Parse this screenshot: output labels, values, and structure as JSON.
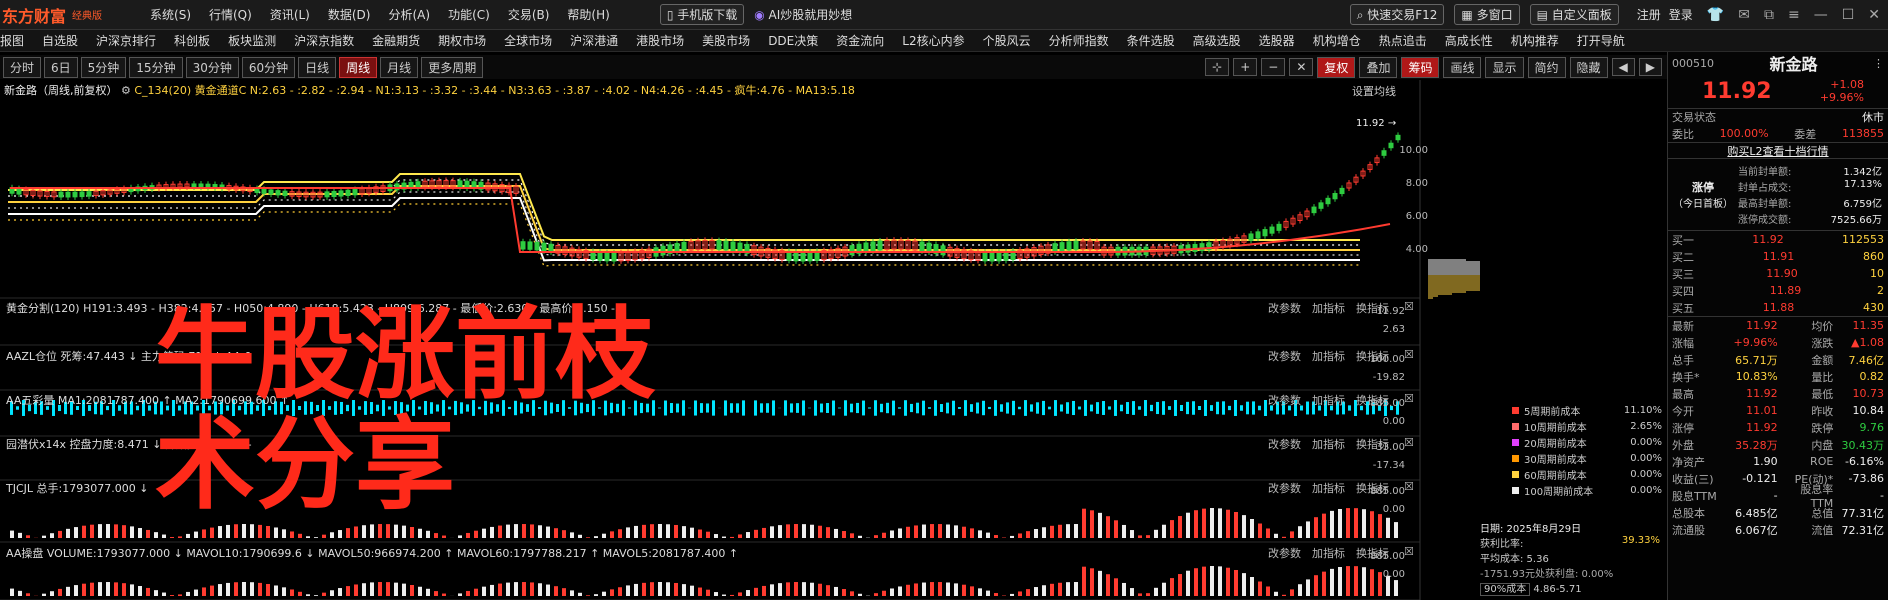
{
  "topbar": {
    "logo": "东方财富",
    "edition": "经典版",
    "menus": [
      "系统(S)",
      "行情(Q)",
      "资讯(L)",
      "数据(D)",
      "分析(A)",
      "功能(C)",
      "交易(B)",
      "帮助(H)"
    ],
    "mobile_download": "手机版下载",
    "ai_promo": "AI炒股就用妙想",
    "quick_trade": "快速交易F12",
    "multi_window": "多窗口",
    "custom_panel": "自定义面板",
    "register": "注册",
    "login": "登录"
  },
  "navrow": [
    "报图",
    "自选股",
    "沪深京排行",
    "科创板",
    "板块监测",
    "沪深京指数",
    "金融期货",
    "期权市场",
    "全球市场",
    "沪深港通",
    "港股市场",
    "美股市场",
    "DDE决策",
    "资金流向",
    "L2核心内参",
    "个股风云",
    "分析师指数",
    "条件选股",
    "高级选股",
    "选股器",
    "机构增仓",
    "热点追击",
    "高成长性",
    "机构推荐",
    "打开导航"
  ],
  "periods": [
    "分时",
    "6日",
    "5分钟",
    "15分钟",
    "30分钟",
    "60分钟",
    "日线",
    "周线",
    "月线",
    "更多周期"
  ],
  "period_selected": "周线",
  "tools": {
    "fuquan": "复权",
    "diejia": "叠加",
    "chouma": "筹码",
    "huaxian": "画线",
    "xianshi": "显示",
    "jianyue": "简约",
    "yincang": "隐藏"
  },
  "main_chart": {
    "stock_label": "新金路（周线,前复权）",
    "indicator_text": "C_134(20)  黄金通道C  N:2.63 - :2.82 - :2.94 - N1:3.13 - :3.32 - :3.44 - N3:3.63 - :3.87 - :4.02 - N4:4.26 - :4.45 - 疯牛:4.76 - MA13:5.18",
    "settings_link": "设置均线",
    "price_marker": "11.92",
    "y_ticks": [
      "10.00",
      "8.00",
      "6.00",
      "4.00"
    ]
  },
  "panes": [
    {
      "label": "黄金分割(120)  H191:3.493 - H382:4.357 - H050:4.890 - H618:5.423 - H809:6.287 - 最低价:2.630 - 最高价:7.150 -",
      "ticks": [
        "11.92",
        "2.63"
      ]
    },
    {
      "label": "AAZL仓位  死筹:47.443 ↓ 主力筹码 715 ↓ AA:0",
      "ticks": [
        "100.00",
        "-19.82"
      ]
    },
    {
      "label": "AA五彩量  MA1:2081787.400 ↑ MA2:1790699.600 ↑",
      "ticks": [
        "885.00",
        "0.00"
      ]
    },
    {
      "label": "园潜伏x14x  控盘力度:8.471 ↓ 开始控盘:0.000 -",
      "ticks": [
        "33.00",
        "-17.34"
      ]
    },
    {
      "label": "TJCJL  总手:1793077.000 ↓",
      "ticks": [
        "885.00",
        "0.00"
      ]
    },
    {
      "label": "AA操盘  VOLUME:1793077.000 ↓ MAVOL10:1790699.6 ↓ MAVOL50:966974.200 ↑ MAVOL60:1797788.217 ↑ MAVOL5:2081787.400 ↑",
      "ticks": [
        "885.00",
        "0.00"
      ]
    }
  ],
  "pane_buttons": {
    "params": "改参数",
    "add": "加指标",
    "switch": "换指标"
  },
  "overlay": {
    "line1": "牛股涨前枝",
    "line2": "术分享"
  },
  "cost_legend": [
    {
      "label": "5周期前成本",
      "value": "11.10%",
      "color": "#ff3b30"
    },
    {
      "label": "10周期前成本",
      "value": "2.65%",
      "color": "#ff6b6b"
    },
    {
      "label": "20周期前成本",
      "value": "0.00%",
      "color": "#e040fb"
    },
    {
      "label": "30周期前成本",
      "value": "0.00%",
      "color": "#ff9800"
    },
    {
      "label": "60周期前成本",
      "value": "0.00%",
      "color": "#ffd23f"
    },
    {
      "label": "100周期前成本",
      "value": "0.00%",
      "color": "#eeeeee"
    }
  ],
  "mid_info": {
    "date": "日期: 2025年8月29日",
    "profit_ratio_label": "获利比率:",
    "profit_ratio": "39.33%",
    "avg_cost": "平均成本: 5.36",
    "extra": "-1751.93元处获利盘: 0.00%",
    "cost_range_sel": "90%成本",
    "cost_range": "4.86-5.71"
  },
  "quote": {
    "code": "000510",
    "name": "新金路",
    "price": "11.92",
    "change": "+1.08",
    "pct": "+9.96%",
    "trade_status_label": "交易状态",
    "trade_status": "休市",
    "weibi_label": "委比",
    "weibi": "100.00%",
    "weicha_label": "委差",
    "weicha": "113855",
    "l2_link": "购买L2查看十档行情",
    "limit_up_label": "涨停",
    "limit_up_sub": "（今日首板）",
    "limit_stats": [
      {
        "k": "当前封单额:",
        "v": "1.342亿"
      },
      {
        "k": "封单占成交:",
        "v": "17.13%"
      },
      {
        "k": "最高封单额:",
        "v": "6.759亿"
      },
      {
        "k": "涨停成交额:",
        "v": "7525.66万"
      }
    ],
    "bids": [
      {
        "k": "买一",
        "p": "11.92",
        "v": "112553"
      },
      {
        "k": "买二",
        "p": "11.91",
        "v": "860"
      },
      {
        "k": "买三",
        "p": "11.90",
        "v": "10"
      },
      {
        "k": "买四",
        "p": "11.89",
        "v": "2"
      },
      {
        "k": "买五",
        "p": "11.88",
        "v": "430"
      }
    ],
    "stats": [
      {
        "k1": "最新",
        "v1": "11.92",
        "c1": "red",
        "k2": "均价",
        "v2": "11.35",
        "c2": "red"
      },
      {
        "k1": "涨幅",
        "v1": "+9.96%",
        "c1": "red",
        "k2": "涨跌",
        "v2": "▲1.08",
        "c2": "red"
      },
      {
        "k1": "总手",
        "v1": "65.71万",
        "c1": "yellow",
        "k2": "金额",
        "v2": "7.46亿",
        "c2": "yellow"
      },
      {
        "k1": "换手*",
        "v1": "10.83%",
        "c1": "yellow",
        "k2": "量比",
        "v2": "0.82",
        "c2": "yellow"
      },
      {
        "k1": "最高",
        "v1": "11.92",
        "c1": "red",
        "k2": "最低",
        "v2": "10.73",
        "c2": "red"
      },
      {
        "k1": "今开",
        "v1": "11.01",
        "c1": "red",
        "k2": "昨收",
        "v2": "10.84",
        "c2": "white"
      },
      {
        "k1": "涨停",
        "v1": "11.92",
        "c1": "red",
        "k2": "跌停",
        "v2": "9.76",
        "c2": "green"
      },
      {
        "k1": "外盘",
        "v1": "35.28万",
        "c1": "red",
        "k2": "内盘",
        "v2": "30.43万",
        "c2": "green"
      },
      {
        "k1": "净资产",
        "v1": "1.90",
        "c1": "white",
        "k2": "ROE",
        "v2": "-6.16%",
        "c2": "white"
      },
      {
        "k1": "收益(三)",
        "v1": "-0.121",
        "c1": "white",
        "k2": "PE(动)*",
        "v2": "-73.86",
        "c2": "white"
      },
      {
        "k1": "股息TTM",
        "v1": "-",
        "c1": "white",
        "k2": "股息率TTM",
        "v2": "-",
        "c2": "white"
      },
      {
        "k1": "总股本",
        "v1": "6.485亿",
        "c1": "white",
        "k2": "总值",
        "v2": "77.31亿",
        "c2": "white"
      },
      {
        "k1": "流通股",
        "v1": "6.067亿",
        "c1": "white",
        "k2": "流值",
        "v2": "72.31亿",
        "c2": "white"
      }
    ]
  },
  "colors": {
    "up": "#ff3b30",
    "down": "#2ecc40",
    "accent": "#ff5a2a",
    "yellow": "#ffd23f"
  }
}
